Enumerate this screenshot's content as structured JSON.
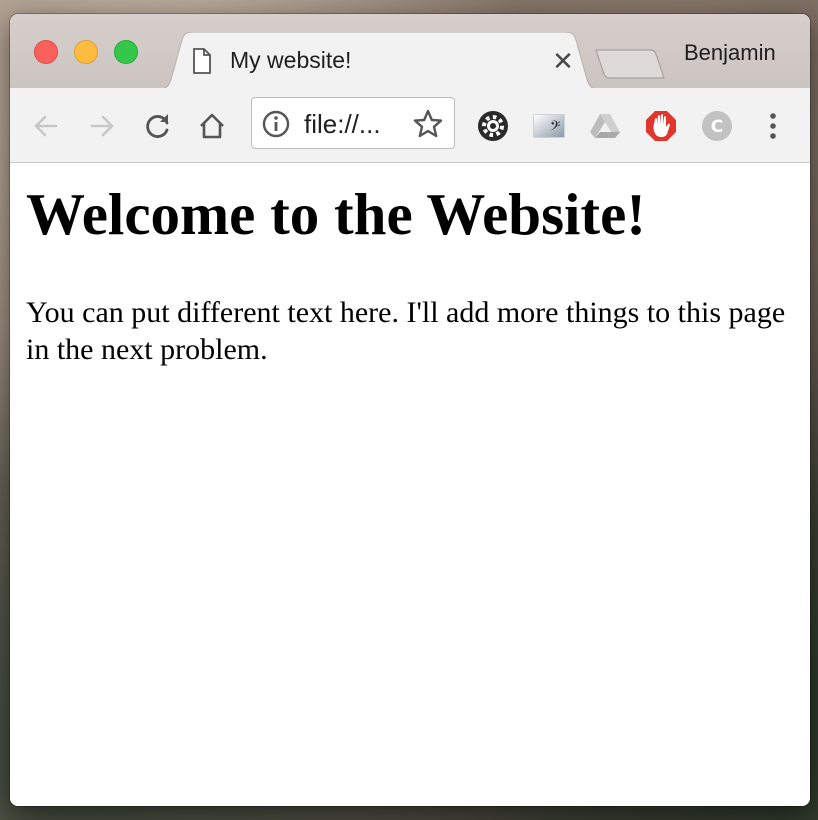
{
  "browser": {
    "tab": {
      "title": "My website!",
      "close_glyph": "✕"
    },
    "profile_name": "Benjamin",
    "address_bar": {
      "url_text": "file://..."
    },
    "icons": {
      "back": "back-arrow-icon",
      "forward": "forward-arrow-icon",
      "reload": "reload-icon",
      "home": "home-icon",
      "info": "info-icon",
      "bookmark": "star-icon",
      "ext1": "gear-extension-icon",
      "ext2": "music-extension-icon",
      "ext3": "google-drive-icon",
      "ext4": "adblock-icon",
      "ext5": "c-extension-icon",
      "menu": "kebab-menu-icon"
    },
    "colors": {
      "close": "#fc605c",
      "minimize": "#fdbc40",
      "maximize": "#34c84a",
      "adblock": "#e0362c"
    }
  },
  "page": {
    "heading": "Welcome to the Website!",
    "paragraph": "You can put different text here. I'll add more things to this page in the next problem."
  }
}
